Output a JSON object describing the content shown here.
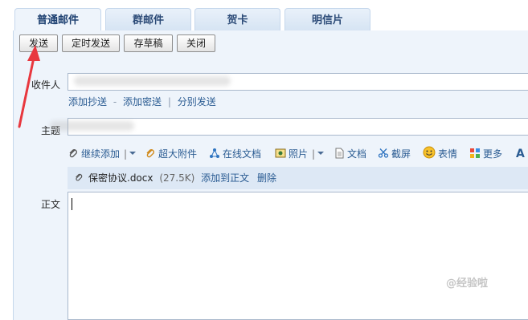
{
  "tabs": [
    {
      "label": "普通邮件",
      "active": true
    },
    {
      "label": "群邮件",
      "active": false
    },
    {
      "label": "贺卡",
      "active": false
    },
    {
      "label": "明信片",
      "active": false
    }
  ],
  "toolbar": {
    "send_label": "发送",
    "scheduled_send_label": "定时发送",
    "save_draft_label": "存草稿",
    "close_label": "关闭"
  },
  "recipient": {
    "label": "收件人",
    "add_cc": "添加抄送",
    "sep1": "-",
    "add_bcc": "添加密送",
    "sep2": "|",
    "separate_send": "分别发送"
  },
  "subject": {
    "label": "主题"
  },
  "attach_toolbar": {
    "continue_add": "继续添加",
    "large_attachment": "超大附件",
    "online_doc": "在线文档",
    "photo": "照片",
    "document": "文档",
    "screenshot": "截屏",
    "emoji": "表情",
    "more": "更多",
    "font": "A"
  },
  "attachment": {
    "filename": "保密协议.docx",
    "size": "(27.5K)",
    "add_to_body": "添加到正文",
    "delete": "删除"
  },
  "body": {
    "label": "正文"
  },
  "watermark": "@经验啦",
  "colors": {
    "accent": "#2a5b92",
    "arrow": "#e8373e"
  }
}
